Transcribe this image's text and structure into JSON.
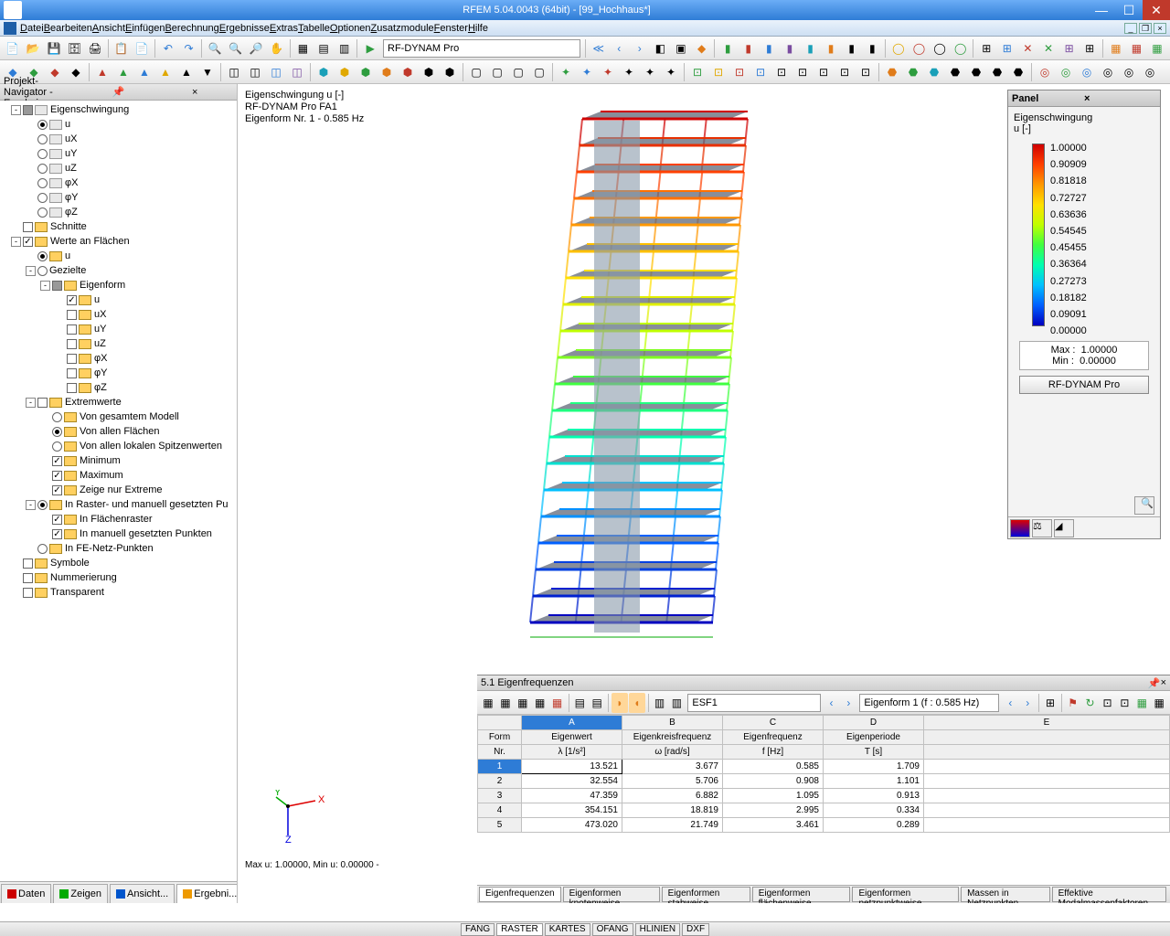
{
  "titlebar": {
    "text": "RFEM 5.04.0043 (64bit) - [99_Hochhaus*]"
  },
  "menu": [
    "Datei",
    "Bearbeiten",
    "Ansicht",
    "Einfügen",
    "Berechnung",
    "Ergebnisse",
    "Extras",
    "Tabelle",
    "Optionen",
    "Zusatzmodule",
    "Fenster",
    "Hilfe"
  ],
  "toolbar_module": "RF-DYNAM Pro",
  "navigator": {
    "title": "Projekt-Navigator - Ergebnisse",
    "tabs": [
      "Daten",
      "Zeigen",
      "Ansicht...",
      "Ergebni..."
    ],
    "tree": [
      {
        "l": 0,
        "exp": "-",
        "chk": "mixed",
        "ico": "b",
        "t": "Eigenschwingung"
      },
      {
        "l": 1,
        "rad": true,
        "ico": "b",
        "t": "u"
      },
      {
        "l": 1,
        "rad": false,
        "ico": "b",
        "t": "uX"
      },
      {
        "l": 1,
        "rad": false,
        "ico": "b",
        "t": "uY"
      },
      {
        "l": 1,
        "rad": false,
        "ico": "b",
        "t": "uZ"
      },
      {
        "l": 1,
        "rad": false,
        "ico": "b",
        "t": "φX"
      },
      {
        "l": 1,
        "rad": false,
        "ico": "b",
        "t": "φY"
      },
      {
        "l": 1,
        "rad": false,
        "ico": "b",
        "t": "φZ"
      },
      {
        "l": 0,
        "chk": false,
        "ico": "y",
        "t": "Schnitte"
      },
      {
        "l": 0,
        "exp": "-",
        "chk": true,
        "ico": "y",
        "t": "Werte an Flächen"
      },
      {
        "l": 1,
        "rad": true,
        "ico": "y",
        "t": "u"
      },
      {
        "l": 1,
        "exp": "-",
        "rad": false,
        "t": "Gezielte"
      },
      {
        "l": 2,
        "exp": "-",
        "chk": "mixed",
        "ico": "y",
        "t": "Eigenform"
      },
      {
        "l": 3,
        "chk": true,
        "ico": "y",
        "t": "u"
      },
      {
        "l": 3,
        "chk": false,
        "ico": "y",
        "t": "uX"
      },
      {
        "l": 3,
        "chk": false,
        "ico": "y",
        "t": "uY"
      },
      {
        "l": 3,
        "chk": false,
        "ico": "y",
        "t": "uZ"
      },
      {
        "l": 3,
        "chk": false,
        "ico": "y",
        "t": "φX"
      },
      {
        "l": 3,
        "chk": false,
        "ico": "y",
        "t": "φY"
      },
      {
        "l": 3,
        "chk": false,
        "ico": "y",
        "t": "φZ"
      },
      {
        "l": 1,
        "exp": "-",
        "chk": false,
        "ico": "y",
        "t": "Extremwerte"
      },
      {
        "l": 2,
        "rad": false,
        "ico": "y",
        "t": "Von gesamtem Modell"
      },
      {
        "l": 2,
        "rad": true,
        "ico": "y",
        "t": "Von allen Flächen"
      },
      {
        "l": 2,
        "rad": false,
        "ico": "y",
        "t": "Von allen lokalen Spitzenwerten"
      },
      {
        "l": 2,
        "chk": true,
        "ico": "y",
        "t": "Minimum"
      },
      {
        "l": 2,
        "chk": true,
        "ico": "y",
        "t": "Maximum"
      },
      {
        "l": 2,
        "chk": true,
        "ico": "y",
        "t": "Zeige nur Extreme"
      },
      {
        "l": 1,
        "exp": "-",
        "rad": true,
        "ico": "y",
        "t": "In Raster- und manuell gesetzten Pu"
      },
      {
        "l": 2,
        "chk": true,
        "ico": "y",
        "t": "In Flächenraster"
      },
      {
        "l": 2,
        "chk": true,
        "ico": "y",
        "t": "In manuell gesetzten Punkten"
      },
      {
        "l": 1,
        "rad": false,
        "ico": "y",
        "t": "In FE-Netz-Punkten"
      },
      {
        "l": 0,
        "chk": false,
        "ico": "y",
        "t": "Symbole"
      },
      {
        "l": 0,
        "chk": false,
        "ico": "y",
        "t": "Nummerierung"
      },
      {
        "l": 0,
        "chk": false,
        "ico": "y",
        "t": "Transparent"
      }
    ]
  },
  "viewport": {
    "line1": "Eigenschwingung u [-]",
    "line2": "RF-DYNAM Pro FA1",
    "line3": "Eigenform Nr. 1 - 0.585 Hz",
    "footer": "Max u: 1.00000, Min u: 0.00000 -"
  },
  "panel": {
    "title": "Panel",
    "heading1": "Eigenschwingung",
    "heading2": "u [-]",
    "legend": [
      "1.00000",
      "0.90909",
      "0.81818",
      "0.72727",
      "0.63636",
      "0.54545",
      "0.45455",
      "0.36364",
      "0.27273",
      "0.18182",
      "0.09091",
      "0.00000"
    ],
    "max_label": "Max  :",
    "max_val": "1.00000",
    "min_label": "Min   :",
    "min_val": "0.00000",
    "button": "RF-DYNAM Pro"
  },
  "results": {
    "title": "5.1 Eigenfrequenzen",
    "dropdown1": "ESF1",
    "dropdown2": "Eigenform 1 (f : 0.585 Hz)",
    "col_letters": [
      "",
      "A",
      "B",
      "C",
      "D",
      "E"
    ],
    "headers_row1": [
      "Form",
      "Eigenwert",
      "Eigenkreisfrequenz",
      "Eigenfrequenz",
      "Eigenperiode",
      ""
    ],
    "headers_row2": [
      "Nr.",
      "λ [1/s²]",
      "ω [rad/s]",
      "f [Hz]",
      "T [s]",
      ""
    ],
    "rows": [
      [
        "1",
        "13.521",
        "3.677",
        "0.585",
        "1.709",
        ""
      ],
      [
        "2",
        "32.554",
        "5.706",
        "0.908",
        "1.101",
        ""
      ],
      [
        "3",
        "47.359",
        "6.882",
        "1.095",
        "0.913",
        ""
      ],
      [
        "4",
        "354.151",
        "18.819",
        "2.995",
        "0.334",
        ""
      ],
      [
        "5",
        "473.020",
        "21.749",
        "3.461",
        "0.289",
        ""
      ]
    ],
    "tabs": [
      "Eigenfrequenzen",
      "Eigenformen knotenweise",
      "Eigenformen stabweise",
      "Eigenformen flächenweise",
      "Eigenformen netzpunktweise",
      "Massen in Netzpunkten",
      "Effektive Modalmassenfaktoren"
    ]
  },
  "statusbar": [
    "FANG",
    "RASTER",
    "KARTES",
    "OFANG",
    "HLINIEN",
    "DXF"
  ],
  "chart_data": {
    "type": "table",
    "title": "5.1 Eigenfrequenzen",
    "columns": [
      "Form Nr.",
      "Eigenwert λ [1/s²]",
      "Eigenkreisfrequenz ω [rad/s]",
      "Eigenfrequenz f [Hz]",
      "Eigenperiode T [s]"
    ],
    "rows": [
      [
        1,
        13.521,
        3.677,
        0.585,
        1.709
      ],
      [
        2,
        32.554,
        5.706,
        0.908,
        1.101
      ],
      [
        3,
        47.359,
        6.882,
        1.095,
        0.913
      ],
      [
        4,
        354.151,
        18.819,
        2.995,
        0.334
      ],
      [
        5,
        473.02,
        21.749,
        3.461,
        0.289
      ]
    ],
    "colorbar": {
      "label": "Eigenschwingung u [-]",
      "min": 0.0,
      "max": 1.0,
      "ticks": [
        1.0,
        0.90909,
        0.81818,
        0.72727,
        0.63636,
        0.54545,
        0.45455,
        0.36364,
        0.27273,
        0.18182,
        0.09091,
        0.0
      ]
    }
  }
}
